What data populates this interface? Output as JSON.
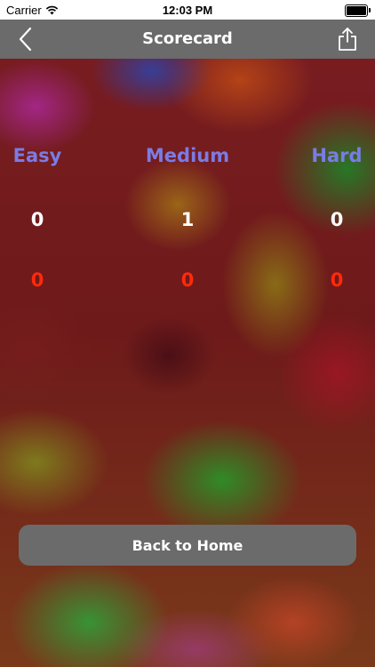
{
  "status_bar": {
    "carrier": "Carrier",
    "time": "12:03 PM"
  },
  "nav": {
    "title": "Scorecard",
    "back_icon": "chevron-left-icon",
    "share_icon": "share-icon"
  },
  "columns": [
    {
      "label": "Easy",
      "score_white": "0",
      "score_red": "0"
    },
    {
      "label": "Medium",
      "score_white": "1",
      "score_red": "0"
    },
    {
      "label": "Hard",
      "score_white": "0",
      "score_red": "0"
    }
  ],
  "colors": {
    "difficulty_label": "#7b7be6",
    "score_primary": "#ffffff",
    "score_secondary": "#ff2a0a",
    "nav_bar": "#6b6b6b"
  },
  "home_button": {
    "label": "Back to Home"
  }
}
